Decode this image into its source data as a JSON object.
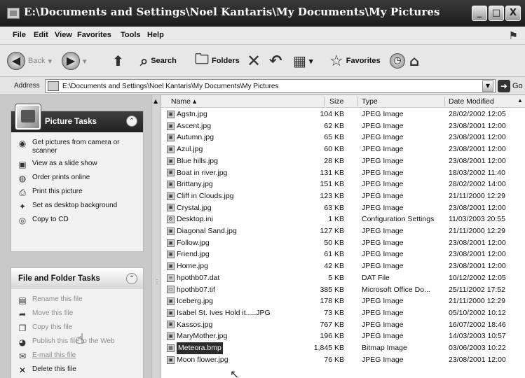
{
  "window": {
    "title": "E:\\Documents and Settings\\Noel Kantaris\\My Documents\\My Pictures",
    "controls": [
      "_",
      "□",
      "X"
    ]
  },
  "menu": [
    "File",
    "Edit",
    "View",
    "Favorites",
    "Tools",
    "Help"
  ],
  "toolbar": {
    "back_label": "Back",
    "search_label": "Search",
    "folders_label": "Folders",
    "favorites_label": "Favorites"
  },
  "address": {
    "label": "Address",
    "path": "E:\\Documents and Settings\\Noel Kantaris\\My Documents\\My Pictures",
    "go_label": "Go"
  },
  "picture_tasks": {
    "title": "Picture Tasks",
    "items": [
      {
        "label": "Get pictures from camera or scanner",
        "icon": "camera-icon",
        "enabled": true
      },
      {
        "label": "View as a slide show",
        "icon": "slideshow-icon",
        "enabled": true
      },
      {
        "label": "Order prints online",
        "icon": "globe-icon",
        "enabled": true
      },
      {
        "label": "Print this picture",
        "icon": "printer-icon",
        "enabled": true
      },
      {
        "label": "Set as desktop background",
        "icon": "desktop-icon",
        "enabled": true
      },
      {
        "label": "Copy to CD",
        "icon": "cd-icon",
        "enabled": true
      }
    ]
  },
  "file_folder_tasks": {
    "title": "File and Folder Tasks",
    "items": [
      {
        "label": "Rename this file",
        "icon": "rename-icon",
        "enabled": false
      },
      {
        "label": "Move this file",
        "icon": "move-icon",
        "enabled": false
      },
      {
        "label": "Copy this file",
        "icon": "copy-icon",
        "enabled": false
      },
      {
        "label": "Publish this file to the Web",
        "icon": "publish-icon",
        "enabled": false
      },
      {
        "label": "E-mail this file",
        "icon": "email-icon",
        "enabled": false
      },
      {
        "label": "Delete this file",
        "icon": "delete-icon",
        "enabled": false
      }
    ]
  },
  "columns": {
    "name": "Name",
    "size": "Size",
    "type": "Type",
    "date": "Date Modified"
  },
  "files": [
    {
      "name": "Agstn.jpg",
      "size": "104 KB",
      "type": "JPEG Image",
      "date": "28/02/2002 12:05",
      "icon": "jpeg-file-icon"
    },
    {
      "name": "Ascent.jpg",
      "size": "62 KB",
      "type": "JPEG Image",
      "date": "23/08/2001 12:00",
      "icon": "jpeg-file-icon"
    },
    {
      "name": "Autumn.jpg",
      "size": "65 KB",
      "type": "JPEG Image",
      "date": "23/08/2001 12:00",
      "icon": "jpeg-file-icon"
    },
    {
      "name": "Azul.jpg",
      "size": "60 KB",
      "type": "JPEG Image",
      "date": "23/08/2001 12:00",
      "icon": "jpeg-file-icon"
    },
    {
      "name": "Blue hills.jpg",
      "size": "28 KB",
      "type": "JPEG Image",
      "date": "23/08/2001 12:00",
      "icon": "jpeg-file-icon"
    },
    {
      "name": "Boat in river.jpg",
      "size": "131 KB",
      "type": "JPEG Image",
      "date": "18/03/2002 11:40",
      "icon": "jpeg-file-icon"
    },
    {
      "name": "Brittany.jpg",
      "size": "151 KB",
      "type": "JPEG Image",
      "date": "28/02/2002 14:00",
      "icon": "jpeg-file-icon"
    },
    {
      "name": "Cliff in Clouds.jpg",
      "size": "123 KB",
      "type": "JPEG Image",
      "date": "21/11/2000 12:29",
      "icon": "jpeg-file-icon"
    },
    {
      "name": "Crystal.jpg",
      "size": "63 KB",
      "type": "JPEG Image",
      "date": "23/08/2001 12:00",
      "icon": "jpeg-file-icon"
    },
    {
      "name": "Desktop.ini",
      "size": "1 KB",
      "type": "Configuration Settings",
      "date": "11/03/2003 20:55",
      "icon": "settings-file-icon"
    },
    {
      "name": "Diagonal Sand.jpg",
      "size": "127 KB",
      "type": "JPEG Image",
      "date": "21/11/2000 12:29",
      "icon": "jpeg-file-icon"
    },
    {
      "name": "Follow.jpg",
      "size": "50 KB",
      "type": "JPEG Image",
      "date": "23/08/2001 12:00",
      "icon": "jpeg-file-icon"
    },
    {
      "name": "Friend.jpg",
      "size": "61 KB",
      "type": "JPEG Image",
      "date": "23/08/2001 12:00",
      "icon": "jpeg-file-icon"
    },
    {
      "name": "Home.jpg",
      "size": "42 KB",
      "type": "JPEG Image",
      "date": "23/08/2001 12:00",
      "icon": "jpeg-file-icon"
    },
    {
      "name": "hpothb07.dat",
      "size": "5 KB",
      "type": "DAT File",
      "date": "10/12/2002 12:05",
      "icon": "dat-file-icon"
    },
    {
      "name": "hpothb07.tif",
      "size": "385 KB",
      "type": "Microsoft Office Do...",
      "date": "25/11/2002 17:52",
      "icon": "tif-file-icon"
    },
    {
      "name": "Iceberg.jpg",
      "size": "178 KB",
      "type": "JPEG Image",
      "date": "21/11/2000 12:29",
      "icon": "jpeg-file-icon"
    },
    {
      "name": "Isabel St. Ives Hold it.....JPG",
      "size": "73 KB",
      "type": "JPEG Image",
      "date": "05/10/2002 10:12",
      "icon": "jpeg-file-icon"
    },
    {
      "name": "Kassos.jpg",
      "size": "767 KB",
      "type": "JPEG Image",
      "date": "16/07/2002 18:46",
      "icon": "jpeg-file-icon"
    },
    {
      "name": "MaryMother.jpg",
      "size": "196 KB",
      "type": "JPEG Image",
      "date": "14/03/2003 10:57",
      "icon": "jpeg-file-icon"
    },
    {
      "name": "Meteora.bmp",
      "size": "1,845 KB",
      "type": "Bitmap Image",
      "date": "03/06/2003 10:22",
      "icon": "bitmap-file-icon",
      "selected": true
    },
    {
      "name": "Moon flower.jpg",
      "size": "76 KB",
      "type": "JPEG Image",
      "date": "23/08/2001 12:00",
      "icon": "jpeg-file-icon"
    }
  ]
}
